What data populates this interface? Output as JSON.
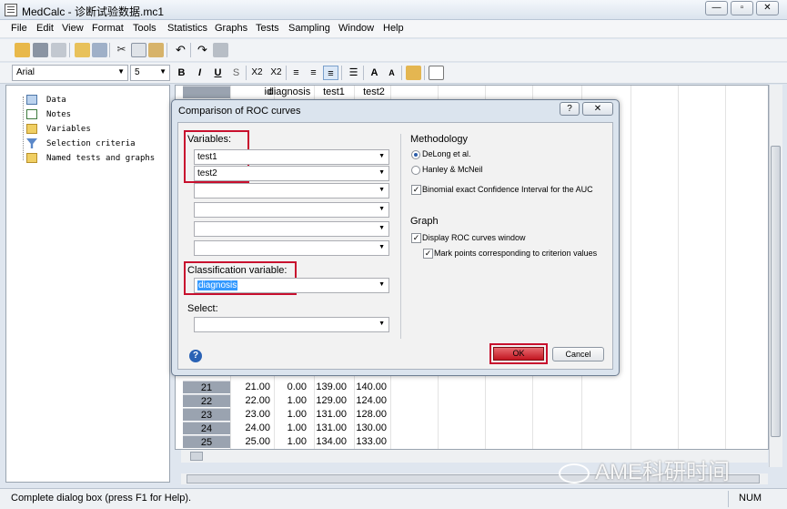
{
  "window": {
    "title": "MedCalc - 诊断试验数据.mc1",
    "minimize_label": "—",
    "restore_label": "▫",
    "close_label": "✕"
  },
  "menu": [
    "File",
    "Edit",
    "View",
    "Format",
    "Tools",
    "Statistics",
    "Graphs",
    "Tests",
    "Sampling",
    "Window",
    "Help"
  ],
  "format_bar": {
    "font": "Arial",
    "size": "5",
    "bold": "B",
    "italic": "I",
    "underline": "U",
    "strike": "S",
    "subscript": "X2",
    "superscript": "X2"
  },
  "tree": {
    "items": [
      "Data",
      "Notes",
      "Variables",
      "Selection criteria",
      "Named tests and graphs"
    ]
  },
  "sheet": {
    "columns": [
      "id",
      "diagnosis",
      "test1",
      "test2"
    ],
    "rows": [
      {
        "n": "21",
        "id": "21.00",
        "diagnosis": "0.00",
        "test1": "139.00",
        "test2": "140.00"
      },
      {
        "n": "22",
        "id": "22.00",
        "diagnosis": "1.00",
        "test1": "129.00",
        "test2": "124.00"
      },
      {
        "n": "23",
        "id": "23.00",
        "diagnosis": "1.00",
        "test1": "131.00",
        "test2": "128.00"
      },
      {
        "n": "24",
        "id": "24.00",
        "diagnosis": "1.00",
        "test1": "131.00",
        "test2": "130.00"
      },
      {
        "n": "25",
        "id": "25.00",
        "diagnosis": "1.00",
        "test1": "134.00",
        "test2": "133.00"
      }
    ]
  },
  "dialog": {
    "title": "Comparison of ROC curves",
    "help_label": "?",
    "close_label": "✕",
    "variables_label": "Variables:",
    "variables": [
      "test1",
      "test2",
      "",
      "",
      "",
      ""
    ],
    "classification_label": "Classification variable:",
    "classification_value": "diagnosis",
    "select_label": "Select:",
    "select_value": "",
    "methodology_heading": "Methodology",
    "method_delong": "DeLong et al.",
    "method_hanley": "Hanley & McNeil",
    "binomial_ci": "Binomial exact Confidence Interval for the AUC",
    "graph_heading": "Graph",
    "display_roc": "Display ROC curves window",
    "mark_points": "Mark points corresponding to criterion values",
    "ok_label": "OK",
    "cancel_label": "Cancel"
  },
  "status": {
    "message": "Complete dialog box (press F1 for Help).",
    "num": "NUM"
  },
  "watermark": "AME科研时间",
  "colors": {
    "highlight_red": "#c8102e",
    "selection_blue": "#3399ff",
    "row_header": "#9aa3b0"
  }
}
